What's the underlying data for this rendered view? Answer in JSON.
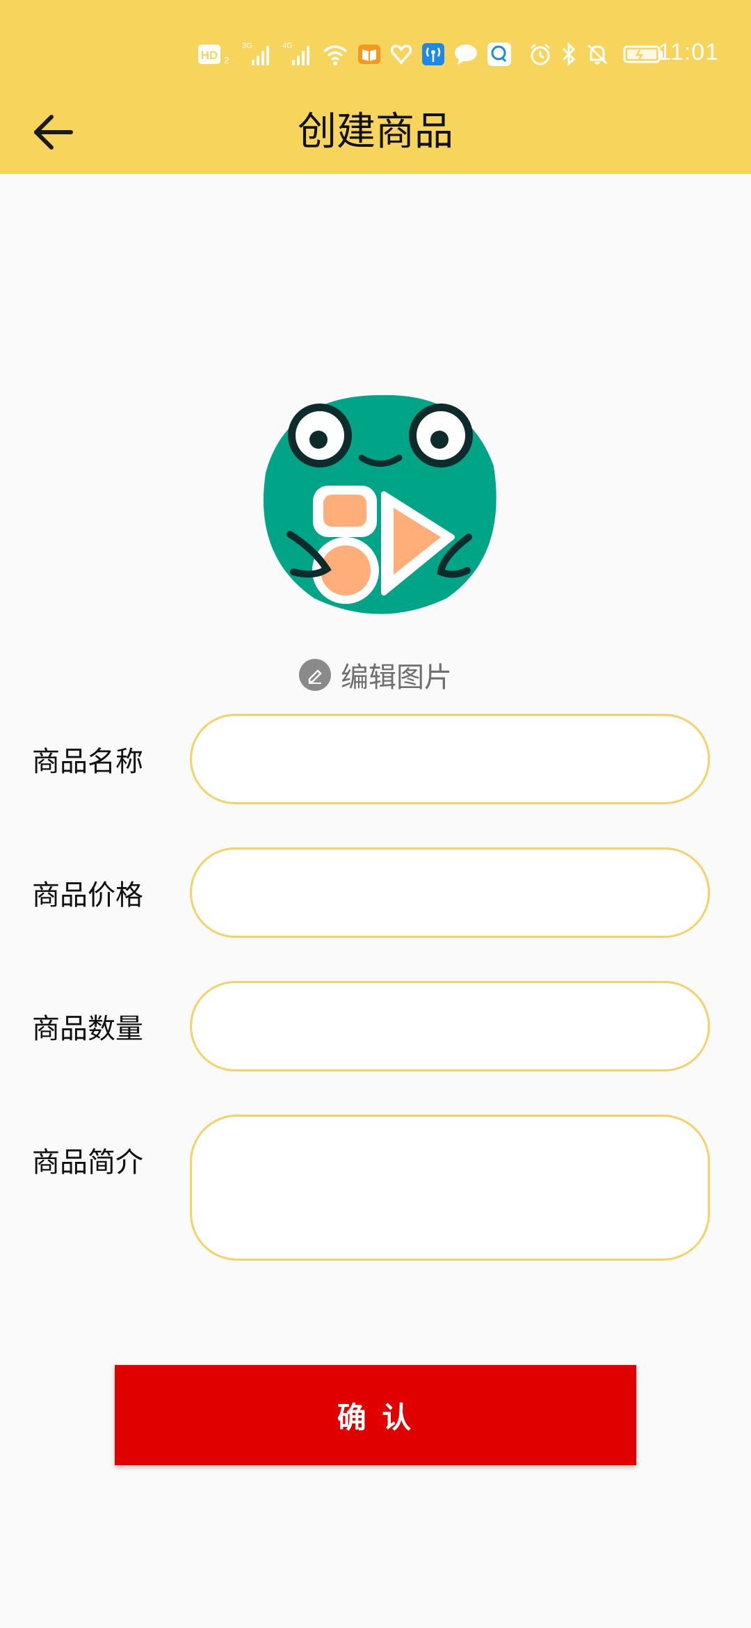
{
  "status_bar": {
    "time": "11:01",
    "icons": [
      "hd-icon",
      "signal-3g-icon",
      "signal-4g-icon",
      "wifi-icon",
      "book-icon",
      "heart-icon",
      "hotspot-icon",
      "chat-icon",
      "message-icon",
      "alarm-icon",
      "bluetooth-icon",
      "mute-bell-icon",
      "battery-icon"
    ]
  },
  "header": {
    "title": "创建商品",
    "back_icon": "back-arrow-icon"
  },
  "image": {
    "edit_label": "编辑图片",
    "edit_icon": "pencil-icon"
  },
  "form": {
    "fields": [
      {
        "label": "商品名称",
        "value": "",
        "placeholder": ""
      },
      {
        "label": "商品价格",
        "value": "",
        "placeholder": ""
      },
      {
        "label": "商品数量",
        "value": "",
        "placeholder": ""
      },
      {
        "label": "商品简介",
        "value": "",
        "placeholder": ""
      }
    ]
  },
  "actions": {
    "confirm_label": "确 认"
  },
  "colors": {
    "header_bg": "#f7d45b",
    "input_border": "#f4d266",
    "confirm_bg": "#e00000",
    "page_bg": "#fafafa"
  }
}
